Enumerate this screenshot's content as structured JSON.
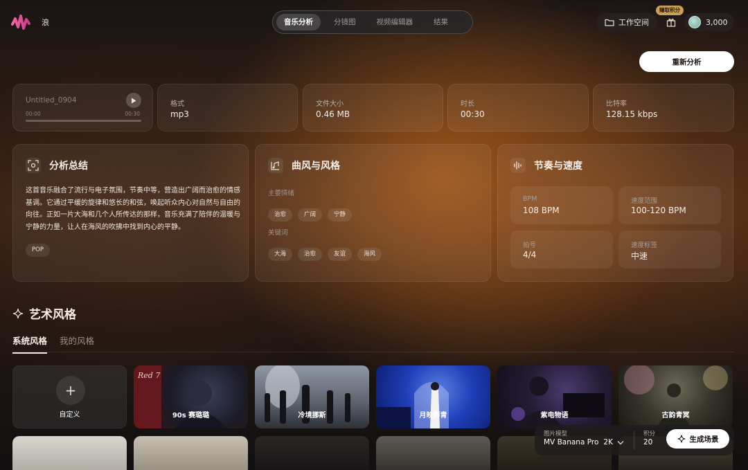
{
  "header": {
    "brand": "浪",
    "tabs": [
      {
        "label": "音乐分析",
        "active": true
      },
      {
        "label": "分镜图",
        "active": false
      },
      {
        "label": "视频编辑器",
        "active": false
      },
      {
        "label": "结果",
        "active": false
      }
    ],
    "workspace_label": "工作空间",
    "earn_badge": "赚取积分",
    "points": "3,000",
    "icons": [
      "logo-waveform-icon",
      "folder-icon",
      "gift-icon"
    ]
  },
  "reanalyze_label": "重新分析",
  "track": {
    "name": "Untitled_0904",
    "time_current": "00:00",
    "time_total": "00:30",
    "progress": 0
  },
  "info": [
    {
      "label": "格式",
      "value": "mp3"
    },
    {
      "label": "文件大小",
      "value": "0.46 MB"
    },
    {
      "label": "时长",
      "value": "00:30"
    },
    {
      "label": "比特率",
      "value": "128.15 kbps"
    }
  ],
  "summary": {
    "title": "分析总结",
    "text": "这首音乐融合了流行与电子氛围，节奏中等，营造出广阔而治愈的情感基调。它通过平缓的旋律和悠长的和弦，唤起听众内心对自然与自由的向往。正如一片大海和几个人所传达的那样，音乐充满了陪伴的温暖与宁静的力量，让人在海风的吹拂中找到内心的平静。",
    "tag": "POP"
  },
  "style": {
    "title": "曲风与风格",
    "mood_label": "主要情绪",
    "moods": [
      "治愈",
      "广阔",
      "宁静"
    ],
    "keyword_label": "关键词",
    "keywords": [
      "大海",
      "治愈",
      "友谊",
      "海风"
    ]
  },
  "rhythm": {
    "title": "节奏与速度",
    "metrics": [
      {
        "label": "BPM",
        "value": "108 BPM"
      },
      {
        "label": "速度范围",
        "value": "100-120 BPM"
      },
      {
        "label": "拍号",
        "value": "4/4"
      },
      {
        "label": "速度标签",
        "value": "中速"
      }
    ]
  },
  "art": {
    "title": "艺术风格",
    "tabs": [
      {
        "label": "系统风格",
        "active": true
      },
      {
        "label": "我的风格",
        "active": false
      }
    ],
    "custom_label": "自定义",
    "styles": [
      "90s 赛璐璐",
      "冷境挪斯",
      "月映群青",
      "紫电物语",
      "古韵青冥"
    ]
  },
  "generate": {
    "model_label": "图片模型",
    "model_value": "MV Banana Pro",
    "resolution": "2K",
    "points_label": "积分",
    "points_value": "20",
    "button": "生成场景"
  },
  "colors": {
    "accent_logo": "#e14b8f",
    "badge": "#c8a158"
  }
}
